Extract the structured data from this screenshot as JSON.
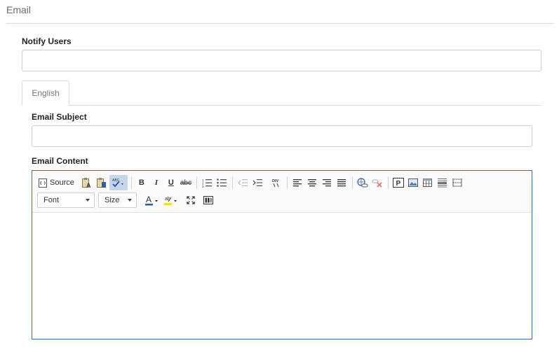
{
  "section": {
    "title": "Email"
  },
  "notify_users": {
    "label": "Notify Users",
    "value": "",
    "placeholder": ""
  },
  "language_tabs": [
    {
      "label": "English",
      "active": true
    }
  ],
  "email_subject": {
    "label": "Email Subject",
    "value": "",
    "placeholder": ""
  },
  "email_content": {
    "label": "Email Content",
    "toolbar": {
      "source_label": "Source",
      "font_label": "Font",
      "size_label": "Size",
      "bold": "B",
      "italic": "I",
      "underline": "U",
      "strike": "abc"
    },
    "body_text": ""
  },
  "colors": {
    "editor_border": "#3a6ea5",
    "spellcheck_active": "#c4d6ea",
    "text_color_bar": "#2a5ea8",
    "highlight_bar": "#f2e600"
  }
}
